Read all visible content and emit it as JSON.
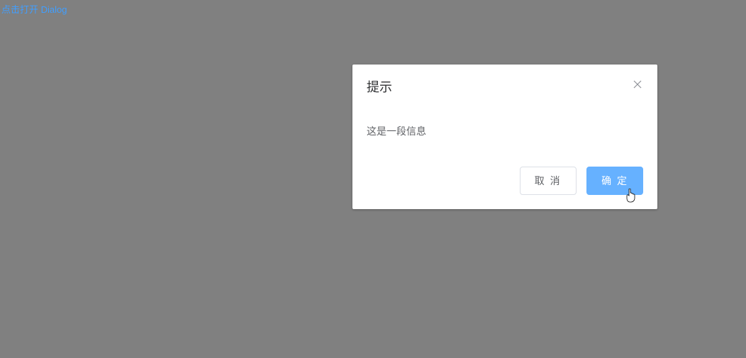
{
  "trigger": {
    "label": "点击打开 Dialog"
  },
  "dialog": {
    "title": "提示",
    "body": "这是一段信息",
    "footer": {
      "cancel_label": "取 消",
      "confirm_label": "确 定"
    }
  }
}
